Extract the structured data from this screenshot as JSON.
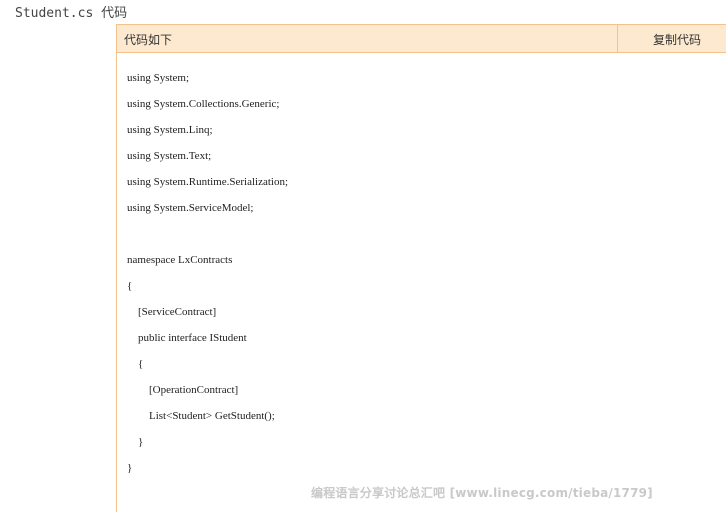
{
  "file_title": "Student.cs 代码",
  "code_box": {
    "header_title": "代码如下",
    "copy_label": "复制代码"
  },
  "code_lines": [
    "using System;",
    "using System.Collections.Generic;",
    "using System.Linq;",
    "using System.Text;",
    "using System.Runtime.Serialization;",
    "using System.ServiceModel;",
    "",
    "namespace LxContracts",
    "{",
    "    [ServiceContract]",
    "    public interface IStudent",
    "    {",
    "        [OperationContract]",
    "        List<Student> GetStudent();",
    "    }",
    "}"
  ],
  "watermark": "编程语言分享讨论总汇吧 [www.linecg.com/tieba/1779]",
  "colors": {
    "header_bg": "#fde9cf",
    "border": "#f3c38a"
  }
}
